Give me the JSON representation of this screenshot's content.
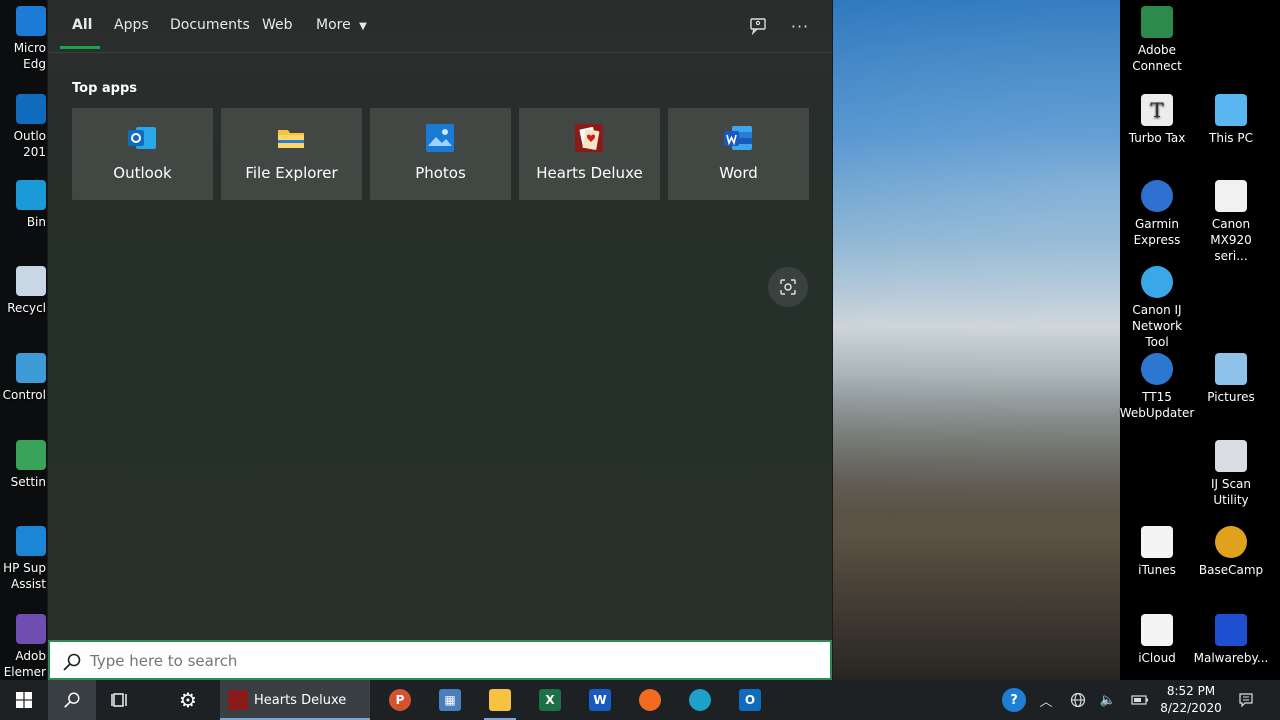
{
  "search_panel": {
    "tabs": [
      "All",
      "Apps",
      "Documents",
      "Web",
      "More"
    ],
    "top_apps_heading": "Top apps",
    "top_apps": [
      {
        "label": "Outlook",
        "icon": "outlook-icon",
        "color": "#0f6cbd"
      },
      {
        "label": "File Explorer",
        "icon": "file-explorer-icon",
        "color": "#f5c242"
      },
      {
        "label": "Photos",
        "icon": "photos-icon",
        "color": "#1a7ad6"
      },
      {
        "label": "Hearts Deluxe",
        "icon": "hearts-deluxe-icon",
        "color": "#8b1a1a"
      },
      {
        "label": "Word",
        "icon": "word-icon",
        "color": "#2b5fb3"
      }
    ],
    "search_placeholder": "Type here to search",
    "accent": "#19a34a"
  },
  "desktop_icons_left": [
    {
      "label": "Micro Edg",
      "icon": "edge-icon"
    },
    {
      "label": "Outlo 201",
      "icon": "outlook-icon"
    },
    {
      "label": "Bin",
      "icon": "bing-icon"
    },
    {
      "label": "Recycl",
      "icon": "recycle-bin-icon"
    },
    {
      "label": "Control",
      "icon": "control-panel-icon"
    },
    {
      "label": "Settin",
      "icon": "settings-icon"
    },
    {
      "label": "HP Sup Assist",
      "icon": "hp-support-icon"
    },
    {
      "label": "Adob Elemer",
      "icon": "adobe-elements-icon"
    }
  ],
  "desktop_icons_right": [
    {
      "label": "Adobe Connect",
      "icon": "adobe-connect-icon"
    },
    {
      "label": "Turbo Tax",
      "icon": "turbotax-icon"
    },
    {
      "label": "This PC",
      "icon": "this-pc-icon"
    },
    {
      "label": "Garmin Express",
      "icon": "garmin-express-icon"
    },
    {
      "label": "Canon MX920 seri...",
      "icon": "canon-printer-icon"
    },
    {
      "label": "Canon IJ Network Tool",
      "icon": "canon-ij-network-icon"
    },
    {
      "label": "TT15 WebUpdater",
      "icon": "tt15-webupdater-icon"
    },
    {
      "label": "Pictures",
      "icon": "pictures-icon"
    },
    {
      "label": "IJ Scan Utility",
      "icon": "ij-scan-icon"
    },
    {
      "label": "iTunes",
      "icon": "itunes-icon"
    },
    {
      "label": "BaseCamp",
      "icon": "basecamp-icon"
    },
    {
      "label": "iCloud",
      "icon": "icloud-icon"
    },
    {
      "label": "Malwareby...",
      "icon": "malwarebytes-icon"
    }
  ],
  "taskbar": {
    "running_app_label": "Hearts Deluxe",
    "time": "8:52 PM",
    "date": "8/22/2020"
  }
}
